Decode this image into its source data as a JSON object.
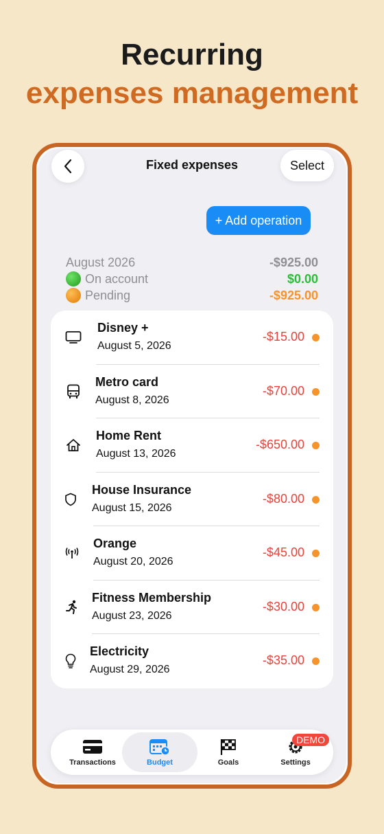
{
  "headline": {
    "line1": "Recurring",
    "line2": "expenses management"
  },
  "nav": {
    "title": "Fixed expenses",
    "select_label": "Select"
  },
  "add_button": "+ Add operation",
  "summary": {
    "month": "August 2026",
    "total": "-$925.00",
    "on_account_label": "On account",
    "on_account_amount": "$0.00",
    "pending_label": "Pending",
    "pending_amount": "-$925.00"
  },
  "expenses": [
    {
      "name": "Disney +",
      "date": "August 5, 2026",
      "amount": "-$15.00",
      "icon": "tv-icon"
    },
    {
      "name": "Metro card",
      "date": "August 8, 2026",
      "amount": "-$70.00",
      "icon": "bus-icon"
    },
    {
      "name": "Home Rent",
      "date": "August 13, 2026",
      "amount": "-$650.00",
      "icon": "house-icon"
    },
    {
      "name": "House Insurance",
      "date": "August 15, 2026",
      "amount": "-$80.00",
      "icon": "shield-icon"
    },
    {
      "name": "Orange",
      "date": "August 20, 2026",
      "amount": "-$45.00",
      "icon": "antenna-icon"
    },
    {
      "name": "Fitness Membership",
      "date": "August 23, 2026",
      "amount": "-$30.00",
      "icon": "runner-icon"
    },
    {
      "name": "Electricity",
      "date": "August 29, 2026",
      "amount": "-$35.00",
      "icon": "lightbulb-icon"
    }
  ],
  "tabs": [
    {
      "label": "Transactions",
      "icon": "credit-card-icon"
    },
    {
      "label": "Budget",
      "icon": "calendar-clock-icon",
      "active": true
    },
    {
      "label": "Goals",
      "icon": "checkered-flag-icon"
    },
    {
      "label": "Settings",
      "icon": "gear-icon",
      "badge": "DEMO"
    }
  ],
  "colors": {
    "background": "#f6e7c9",
    "accent_orange": "#cf6a23",
    "primary_blue": "#1a8cf5",
    "negative_red": "#e8423a",
    "positive_green": "#2dbb3a",
    "pending_orange": "#f7932b"
  }
}
